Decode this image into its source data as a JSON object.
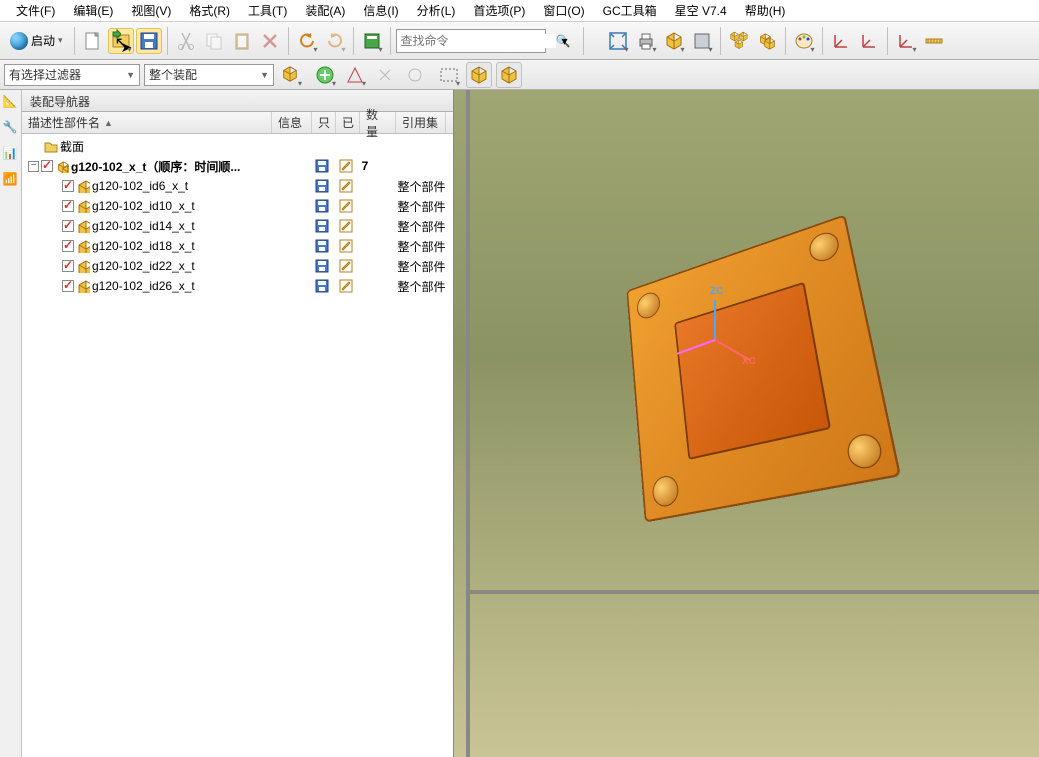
{
  "menubar": [
    "文件(F)",
    "编辑(E)",
    "视图(V)",
    "格式(R)",
    "工具(T)",
    "装配(A)",
    "信息(I)",
    "分析(L)",
    "首选项(P)",
    "窗口(O)",
    "GC工具箱",
    "星空 V7.4",
    "帮助(H)"
  ],
  "toolbar": {
    "start_label": "启动",
    "search_placeholder": "查找命令"
  },
  "filterbar": {
    "filter1": "有选择过滤器",
    "filter2": "整个装配"
  },
  "navigator": {
    "title": "装配导航器",
    "headers": {
      "name": "描述性部件名",
      "info": "信息",
      "only": "只",
      "ro": "已",
      "qty": "数量",
      "ref": "引用集"
    },
    "tree": {
      "section": "截面",
      "root": {
        "name": "g120-102_x_t（顺序：时间顺...",
        "qty": "7",
        "children": [
          {
            "name": "g120-102_id6_x_t",
            "ref": "整个部件"
          },
          {
            "name": "g120-102_id10_x_t",
            "ref": "整个部件"
          },
          {
            "name": "g120-102_id14_x_t",
            "ref": "整个部件"
          },
          {
            "name": "g120-102_id18_x_t",
            "ref": "整个部件"
          },
          {
            "name": "g120-102_id22_x_t",
            "ref": "整个部件"
          },
          {
            "name": "g120-102_id26_x_t",
            "ref": "整个部件"
          }
        ]
      }
    }
  },
  "axes": {
    "x": "XC",
    "z": "ZC"
  }
}
